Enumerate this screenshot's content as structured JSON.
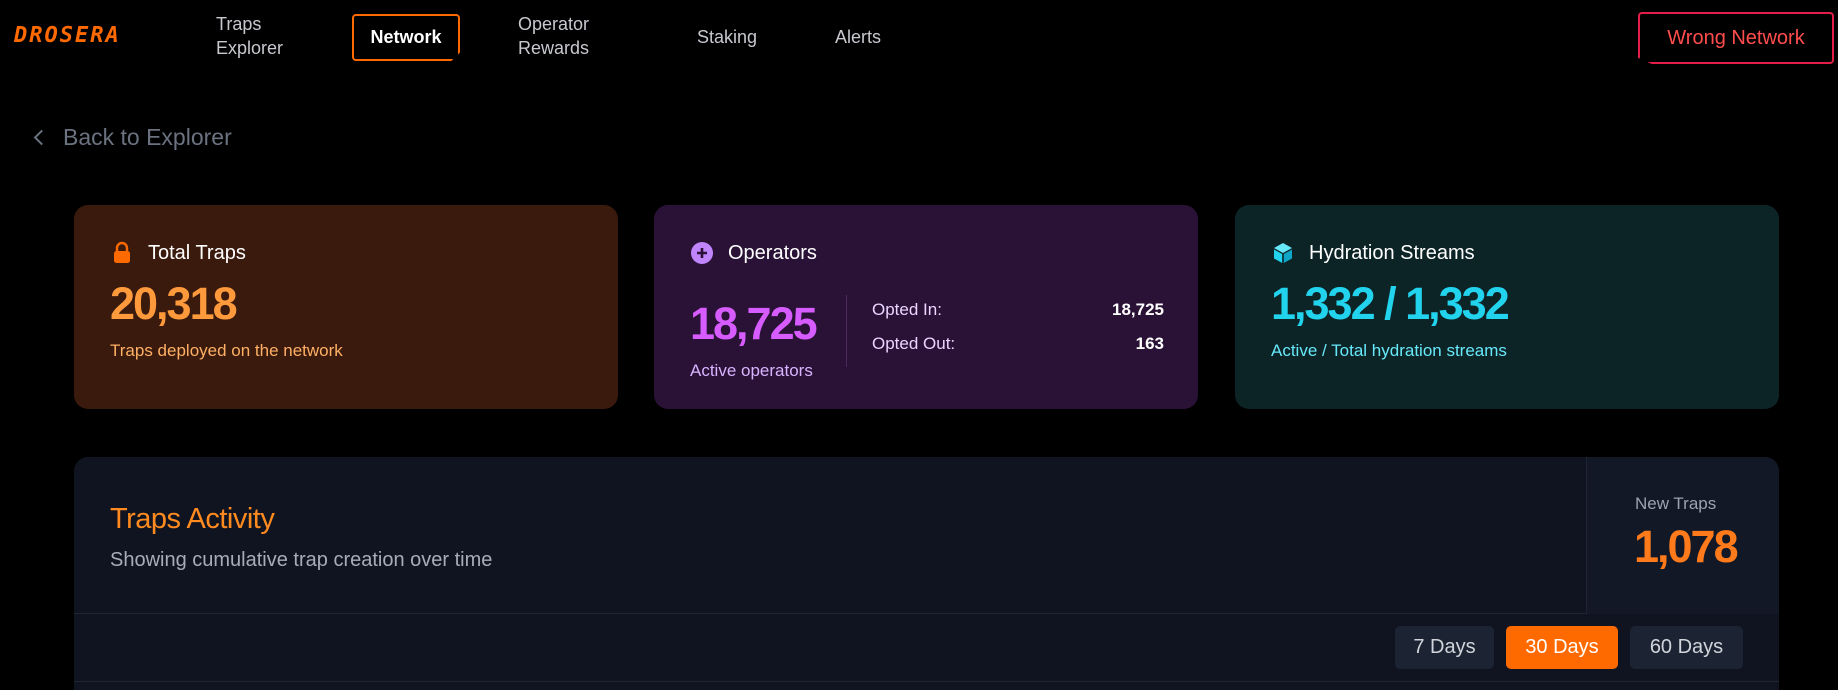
{
  "nav": {
    "logo": "DROSERA",
    "items": [
      {
        "label": "Traps\nExplorer"
      },
      {
        "label": "Network"
      },
      {
        "label": "Operator\nRewards"
      },
      {
        "label": "Staking"
      },
      {
        "label": "Alerts"
      }
    ],
    "wallet_button": "Wrong Network"
  },
  "back_link": "Back to Explorer",
  "cards": {
    "traps": {
      "title": "Total Traps",
      "value": "20,318",
      "subtitle": "Traps deployed on the network",
      "icon": "lock-icon"
    },
    "operators": {
      "title": "Operators",
      "value": "18,725",
      "subtitle": "Active operators",
      "icon": "plus-circle-icon",
      "opted_in_label": "Opted In:",
      "opted_in_value": "18,725",
      "opted_out_label": "Opted Out:",
      "opted_out_value": "163"
    },
    "hydration": {
      "title": "Hydration Streams",
      "value": "1,332 / 1,332",
      "subtitle": "Active / Total hydration streams",
      "icon": "cube-icon"
    }
  },
  "activity": {
    "title": "Traps Activity",
    "description": "Showing cumulative trap creation over time",
    "new_traps_label": "New Traps",
    "new_traps_value": "1,078",
    "ranges": [
      {
        "label": "7 Days",
        "active": false
      },
      {
        "label": "30 Days",
        "active": true
      },
      {
        "label": "60 Days",
        "active": false
      }
    ]
  },
  "colors": {
    "accent": "#ff6a00",
    "danger": "#e11d48",
    "operators": "#d65cff",
    "hydration": "#22d3ee"
  }
}
